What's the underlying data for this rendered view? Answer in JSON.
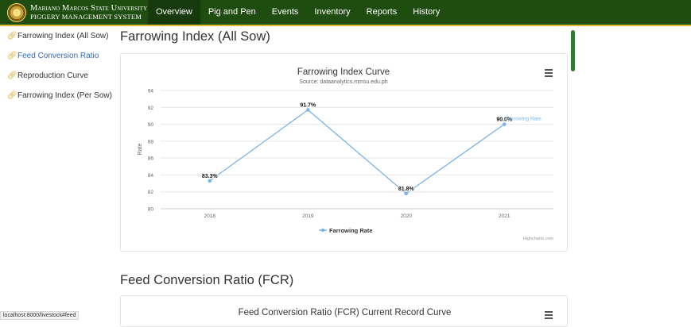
{
  "brand": {
    "line1": "Mariano Marcos State University",
    "line2": "PIGGERY MANAGEMENT SYSTEM"
  },
  "nav": {
    "items": [
      "Overview",
      "Pig and Pen",
      "Events",
      "Inventory",
      "Reports",
      "History"
    ]
  },
  "sidebar": {
    "items": [
      "Farrowing Index (All Sow)",
      "Feed Conversion Ratio",
      "Reproduction Curve",
      "Farrowing Index (Per Sow)"
    ]
  },
  "main": {
    "title": "Farrowing Index (All Sow)",
    "section2_title": "Feed Conversion Ratio (FCR)",
    "card2_title": "Feed Conversion Ratio (FCR) Current Record Curve"
  },
  "status": {
    "url": "localhost:8000/livestock#feed"
  },
  "colors": {
    "nav_bg": "#1e4d0f",
    "nav_border": "#e2b92f",
    "series": "#7cb5ec",
    "link": "#2a6db8"
  },
  "chart_data": {
    "type": "line",
    "title": "Farrowing Index Curve",
    "subtitle": "Source: dataanalytics.mmsu.edu.ph",
    "ylabel": "Rate",
    "ylim": [
      80,
      94
    ],
    "yticks": [
      "80",
      "82",
      "84",
      "86",
      "88",
      "90",
      "92",
      "94"
    ],
    "categories": [
      "2018",
      "2019",
      "2020",
      "2021"
    ],
    "series": [
      {
        "name": "Farrowing Rate",
        "values": [
          83.3,
          91.7,
          81.8,
          90.0
        ],
        "labels": [
          "83.3%",
          "91.7%",
          "81.8%",
          "90.0%"
        ]
      }
    ],
    "end_label": "Farrowing Rate",
    "legend": "bottom-center",
    "credits": "Highcharts.com"
  }
}
